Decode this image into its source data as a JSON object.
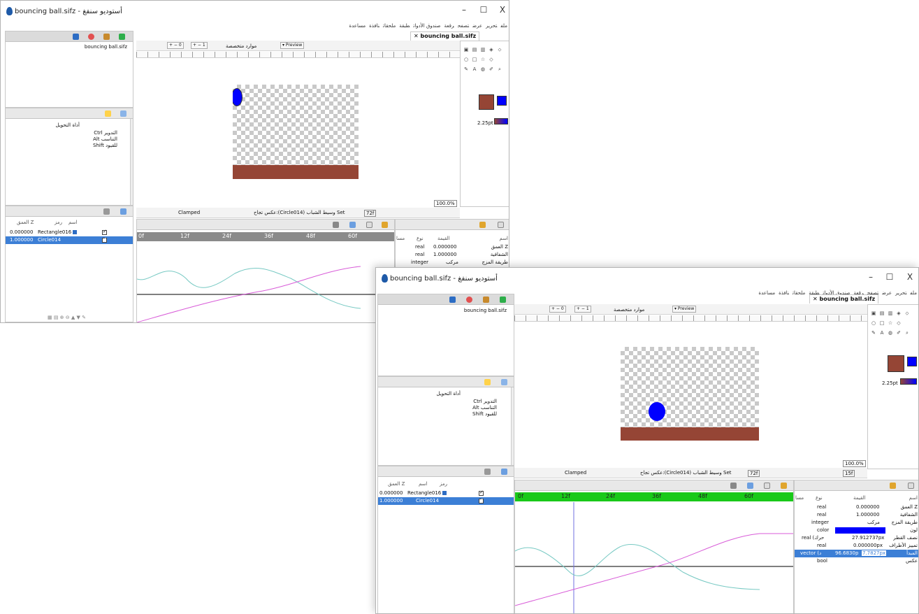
{
  "window_a": {
    "title": "bouncing ball.sifz - أستوديو سنفغ",
    "tab_label": "bouncing ball.sifz",
    "canvas_file_label": "bouncing ball.sifz",
    "zoom": "100.0%",
    "frame_field": "72f",
    "frame_start": "0",
    "frame_step": "1",
    "interp": "Clamped",
    "status_text": "عكس تجاح:(Circle014) وسيط الشباب Set"
  },
  "window_b": {
    "title": "bouncing ball.sifz - أستوديو سنفغ",
    "tab_label": "bouncing ball.sifz",
    "canvas_file_label": "bouncing ball.sifz",
    "zoom": "100.0%",
    "frame_field": "72f",
    "current_frame": "15f",
    "frame_start": "0",
    "frame_step": "1",
    "interp": "Clamped",
    "status_text": "عكس تجاح:(Circle014) وسيط الشباب Set"
  },
  "menu_items": [
    "ملف",
    "تحرير",
    "عرض",
    "تصفح",
    "رقعة",
    "صندوق الأدوات",
    "طبقة",
    "ملحقات",
    "نافذة",
    "مساعدة"
  ],
  "window_controls": {
    "minimize": "–",
    "maximize": "☐",
    "close": "X"
  },
  "toolbar": {
    "preview_label": "Preview",
    "resources_label": "موارد متخصصة",
    "ruler_ticks": [
      "100",
      "150",
      "500",
      "450",
      "400",
      "350",
      "300",
      "250",
      "200",
      "150",
      "100",
      "50",
      "0",
      "50",
      "100",
      "150",
      "200",
      "250",
      "300",
      "350",
      "400",
      "450",
      "500",
      "550"
    ]
  },
  "tool_options": {
    "title": "أداة التحويل",
    "lines": [
      "Ctrl التدوير",
      "Alt التناسب",
      "Shift للقيود"
    ]
  },
  "layers": {
    "headers": {
      "depth": "العمق Z",
      "icon": "رمز",
      "name": "اسم"
    },
    "rows": [
      {
        "depth": "0.000000",
        "name": "Rectangle016",
        "checked": true,
        "selected": false
      },
      {
        "depth": "1.000000",
        "name": "Circle014",
        "checked": true,
        "selected": true
      }
    ]
  },
  "timeline": {
    "ticks": [
      "0f",
      "12f",
      "24f",
      "36f",
      "48f",
      "60f"
    ]
  },
  "params_a": {
    "headers": {
      "name": "اسم",
      "value": "القيمة",
      "type": "نوع",
      "extra": "مسا"
    },
    "rows": [
      {
        "name": "العمق Z",
        "value": "0.000000",
        "type": "real"
      },
      {
        "name": "الشفافية",
        "value": "1.000000",
        "type": "real"
      },
      {
        "name": "طريقة المزج",
        "value": "مركب",
        "type": "integer"
      }
    ]
  },
  "params_b": {
    "headers": {
      "name": "اسم",
      "value": "القيمة",
      "type": "نوع",
      "extra": "مسا"
    },
    "rows": [
      {
        "name": "العمق Z",
        "value": "0.000000",
        "type": "real"
      },
      {
        "name": "الشفافية",
        "value": "1.000000",
        "type": "real"
      },
      {
        "name": "طريقة المزج",
        "value": "مركب",
        "type": "integer"
      },
      {
        "name": "لون",
        "value": "",
        "type": "color"
      },
      {
        "name": "نصف القطر",
        "value": "27.912737px",
        "type": "real (حرك"
      },
      {
        "name": "تمييز الأطراف",
        "value": "0.000000px",
        "type": "real"
      },
      {
        "name": "المبدأ",
        "value": "96.6830p",
        "value2": "7.7827px",
        "type": "vector (د"
      },
      {
        "name": "عكس",
        "value": "",
        "type": "bool"
      }
    ]
  },
  "brush_size": "2.25pt",
  "colors": {
    "outline": "#954535",
    "fill": "#0000ff",
    "ground": "#954535",
    "ball": "#0000ff",
    "selection": "#3c7fd6",
    "timeline_green": "#19c919"
  }
}
